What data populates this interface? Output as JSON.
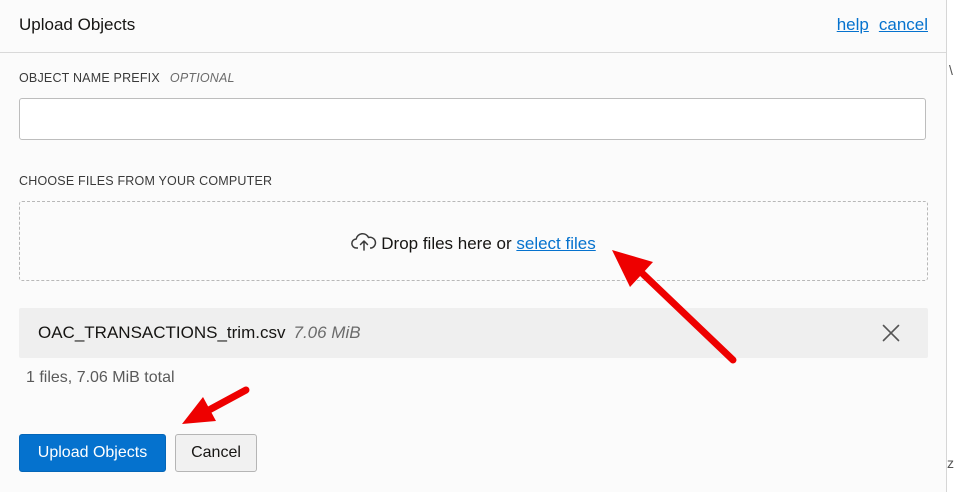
{
  "dialog": {
    "title": "Upload Objects",
    "help_link": "help",
    "cancel_link": "cancel"
  },
  "prefix": {
    "label": "OBJECT NAME PREFIX",
    "optional": "OPTIONAL",
    "value": ""
  },
  "choose": {
    "label": "CHOOSE FILES FROM YOUR COMPUTER",
    "drop_text": "Drop files here or",
    "select_link": "select files",
    "icon": "cloud-upload-icon"
  },
  "files": [
    {
      "name": "OAC_TRANSACTIONS_trim.csv",
      "size": "7.06 MiB"
    }
  ],
  "summary": "1 files, 7.06 MiB total",
  "buttons": {
    "upload": "Upload Objects",
    "cancel": "Cancel"
  },
  "colors": {
    "accent": "#0572ce",
    "annotation_arrow": "#ee0000"
  }
}
